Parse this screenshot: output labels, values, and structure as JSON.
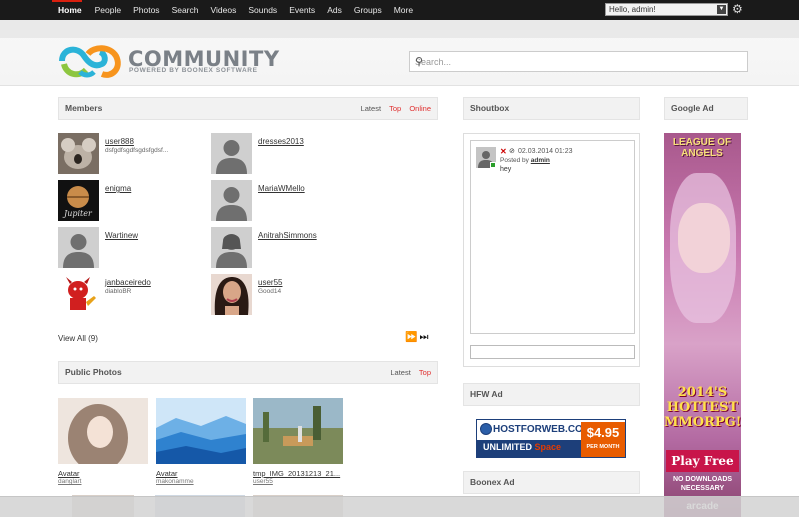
{
  "topnav": {
    "items": [
      "Home",
      "People",
      "Photos",
      "Search",
      "Videos",
      "Sounds",
      "Events",
      "Ads",
      "Groups",
      "More"
    ],
    "user_label": "Hello, admin!"
  },
  "logo": {
    "title": "COMMUNITY",
    "subtitle": "POWERED BY BOONEX SOFTWARE"
  },
  "search": {
    "placeholder": "Search..."
  },
  "members": {
    "title": "Members",
    "tabs": [
      "Latest",
      "Top",
      "Online"
    ],
    "list": [
      {
        "name": "user888",
        "sub": "dsfgdfsgdfsgdsfgdsf..."
      },
      {
        "name": "dresses2013",
        "sub": ""
      },
      {
        "name": "enigma",
        "sub": ""
      },
      {
        "name": "MariaWMello",
        "sub": ""
      },
      {
        "name": "Wartinew",
        "sub": ""
      },
      {
        "name": "AnitrahSimmons",
        "sub": ""
      },
      {
        "name": "janbaceiredo",
        "sub": "diabloBR"
      },
      {
        "name": "user55",
        "sub": "Good14"
      }
    ],
    "view_all": "View All (9)"
  },
  "photos": {
    "title": "Public Photos",
    "tabs": [
      "Latest",
      "Top"
    ],
    "list": [
      {
        "title": "Avatar",
        "user": "danglart"
      },
      {
        "title": "Avatar",
        "user": "makonamme"
      },
      {
        "title": "tmp_IMG_20131213_21...",
        "user": "user55"
      }
    ]
  },
  "shoutbox": {
    "title": "Shoutbox",
    "date": "02.03.2014 01:23",
    "posted_by_prefix": "Posted by",
    "posted_by_user": "admin",
    "message": "hey"
  },
  "hfw": {
    "title": "HFW Ad",
    "brand": "HOSTFORWEB.COM",
    "unlimited": "UNLIMITED",
    "space": "Space",
    "price": "$4.95",
    "per": "PER MONTH"
  },
  "boonex": {
    "title": "Boonex Ad"
  },
  "google": {
    "title": "Google Ad",
    "game": "LEAGUE OF ANGELS",
    "year_line1": "2014'S",
    "year_line2": "HOTTEST",
    "year_line3": "MMORPG!",
    "play": "Play Free",
    "nodl": "NO DOWNLOADS NECESSARY",
    "brand": "arcade"
  },
  "colors": {
    "accent": "#d9200f",
    "tab_active": "#e03030",
    "topbar": "#1a1a1a"
  }
}
